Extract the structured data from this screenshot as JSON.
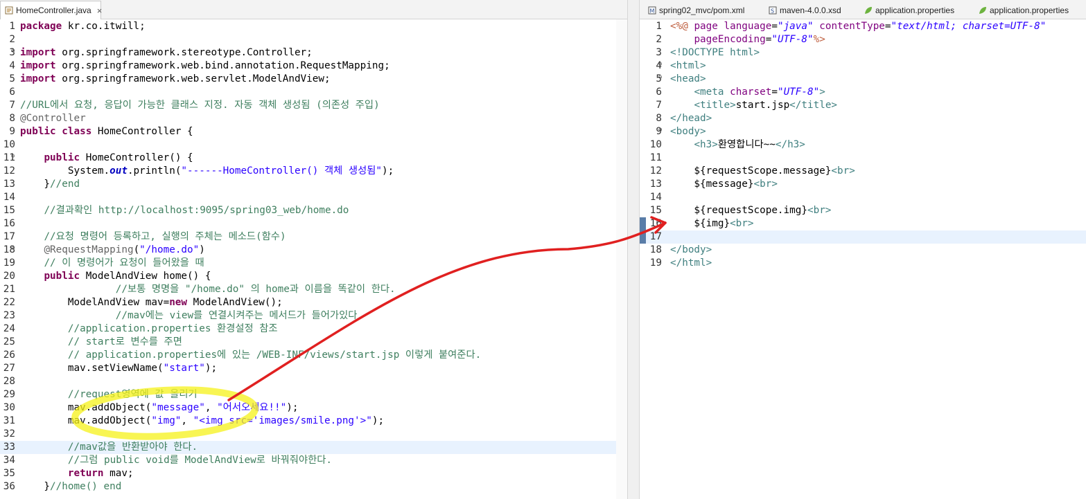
{
  "left_editor": {
    "tab": {
      "label": "HomeController.java",
      "close": "×"
    },
    "lines": [
      {
        "n": "1",
        "html": "<span class=\"kw\">package</span> kr.co.itwill;"
      },
      {
        "n": "2",
        "html": ""
      },
      {
        "n": "3",
        "fold": true,
        "html": "<span class=\"kw\">import</span> org.springframework.stereotype.Controller;"
      },
      {
        "n": "4",
        "html": "<span class=\"kw\">import</span> org.springframework.web.bind.annotation.RequestMapping;"
      },
      {
        "n": "5",
        "html": "<span class=\"kw\">import</span> org.springframework.web.servlet.ModelAndView;"
      },
      {
        "n": "6",
        "html": ""
      },
      {
        "n": "7",
        "html": "<span class=\"cm\">//URL에서 요청, 응답이 가능한 클래스 지정. 자동 객체 생성됨 (의존성 주입)</span>"
      },
      {
        "n": "8",
        "html": "<span class=\"an\">@Controller</span>"
      },
      {
        "n": "9",
        "html": "<span class=\"kw\">public</span> <span class=\"kw\">class</span> HomeController {"
      },
      {
        "n": "10",
        "html": ""
      },
      {
        "n": "11",
        "fold": true,
        "html": "    <span class=\"kw\">public</span> HomeController() {"
      },
      {
        "n": "12",
        "html": "        System.<span class=\"fld\">out</span>.println(<span class=\"st\">\"------HomeController() 객체 생성됨\"</span>);"
      },
      {
        "n": "13",
        "html": "    }<span class=\"cm\">//end</span>"
      },
      {
        "n": "14",
        "html": ""
      },
      {
        "n": "15",
        "html": "    <span class=\"cm\">//결과확인 http://localhost:9095/spring03_web/home.do</span>"
      },
      {
        "n": "16",
        "html": ""
      },
      {
        "n": "17",
        "html": "    <span class=\"cm\">//요청 명령어 등록하고, 실행의 주체는 메소드(함수)</span>"
      },
      {
        "n": "18",
        "fold": true,
        "html": "    <span class=\"an\">@RequestMapping</span>(<span class=\"st\">\"/home.do\"</span>)"
      },
      {
        "n": "19",
        "html": "    <span class=\"cm\">// 이 명령어가 요청이 들어왔을 때</span>"
      },
      {
        "n": "20",
        "html": "    <span class=\"kw\">public</span> ModelAndView home() {"
      },
      {
        "n": "21",
        "html": "                <span class=\"cm\">//보통 명명을 \"/home.do\" 의 home과 이름을 똑같이 한다.</span>"
      },
      {
        "n": "22",
        "html": "        ModelAndView mav=<span class=\"kw\">new</span> ModelAndView();"
      },
      {
        "n": "23",
        "html": "                <span class=\"cm\">//mav에는 view를 연결시켜주는 메서드가 들어가있다.</span>"
      },
      {
        "n": "24",
        "html": "        <span class=\"cm\">//application.properties 환경설정 참조</span>"
      },
      {
        "n": "25",
        "html": "        <span class=\"cm\">// start로 변수를 주면</span>"
      },
      {
        "n": "26",
        "html": "        <span class=\"cm\">// application.properties에 있는 /WEB-INF/views/start.jsp 이렇게 붙여준다.</span>"
      },
      {
        "n": "27",
        "html": "        mav.setViewName(<span class=\"st\">\"start\"</span>);"
      },
      {
        "n": "28",
        "html": ""
      },
      {
        "n": "29",
        "html": "        <span class=\"cm\">//request영역에 값 올리기</span>"
      },
      {
        "n": "30",
        "html": "        mav.addObject(<span class=\"st\">\"message\"</span>, <span class=\"st\">\"어서오세요!!\"</span>);"
      },
      {
        "n": "31",
        "html": "        mav.addObject(<span class=\"st\">\"img\"</span>, <span class=\"st\">\"&lt;img src='images/smile.png'&gt;\"</span>);"
      },
      {
        "n": "32",
        "html": ""
      },
      {
        "n": "33",
        "hl": true,
        "html": "        <span class=\"cm\">//mav값을 반환받아야 한다.</span>"
      },
      {
        "n": "34",
        "html": "        <span class=\"cm\">//그럼 public void를 ModelAndView로 바꿔줘야한다.</span>"
      },
      {
        "n": "35",
        "html": "        <span class=\"kw\">return</span> mav;"
      },
      {
        "n": "36",
        "html": "    }<span class=\"cm\">//home() end</span>"
      }
    ]
  },
  "right_editor": {
    "tabs": [
      {
        "label": "spring02_mvc/pom.xml",
        "icon": "maven-icon"
      },
      {
        "label": "maven-4.0.0.xsd",
        "icon": "xsd-icon"
      },
      {
        "label": "application.properties",
        "icon": "spring-leaf-icon"
      },
      {
        "label": "application.properties",
        "icon": "spring-leaf-icon"
      }
    ],
    "lines": [
      {
        "n": "1",
        "html": "<span class=\"jsp\">&lt;%@</span> <span class=\"at\">page</span> <span class=\"at\">language</span>=<span class=\"av\">\"java\"</span> <span class=\"at\">contentType</span>=<span class=\"av\">\"text/html; charset=UTF-8\"</span>"
      },
      {
        "n": "2",
        "html": "    <span class=\"at\">pageEncoding</span>=<span class=\"av\">\"UTF-8\"</span><span class=\"jsp\">%&gt;</span>"
      },
      {
        "n": "3",
        "html": "<span class=\"tg\">&lt;!DOCTYPE html&gt;</span>"
      },
      {
        "n": "4",
        "fold": true,
        "html": "<span class=\"tg\">&lt;html&gt;</span>"
      },
      {
        "n": "5",
        "fold": true,
        "html": "<span class=\"tg\">&lt;head&gt;</span>"
      },
      {
        "n": "6",
        "html": "    <span class=\"tg\">&lt;meta</span> <span class=\"at\">charset</span>=<span class=\"av\">\"UTF-8\"</span><span class=\"tg\">&gt;</span>"
      },
      {
        "n": "7",
        "html": "    <span class=\"tg\">&lt;title&gt;</span>start.jsp<span class=\"tg\">&lt;/title&gt;</span>"
      },
      {
        "n": "8",
        "html": "<span class=\"tg\">&lt;/head&gt;</span>"
      },
      {
        "n": "9",
        "fold": true,
        "html": "<span class=\"tg\">&lt;body&gt;</span>"
      },
      {
        "n": "10",
        "html": "    <span class=\"tg\">&lt;h3&gt;</span>환영합니다~~<span class=\"tg\">&lt;/h3&gt;</span>"
      },
      {
        "n": "11",
        "html": ""
      },
      {
        "n": "12",
        "html": "    ${requestScope.message}<span class=\"tg\">&lt;br&gt;</span>"
      },
      {
        "n": "13",
        "html": "    ${message}<span class=\"tg\">&lt;br&gt;</span>"
      },
      {
        "n": "14",
        "html": ""
      },
      {
        "n": "15",
        "html": "    ${requestScope.img}<span class=\"tg\">&lt;br&gt;</span>"
      },
      {
        "n": "16",
        "marker": true,
        "html": "    ${img}<span class=\"tg\">&lt;br&gt;</span>"
      },
      {
        "n": "17",
        "hl": true,
        "marker": true,
        "html": ""
      },
      {
        "n": "18",
        "html": "<span class=\"tg\">&lt;/body&gt;</span>"
      },
      {
        "n": "19",
        "html": "<span class=\"tg\">&lt;/html&gt;</span>"
      }
    ]
  },
  "annotation": {
    "arrow_color": "#e02020",
    "highlight_color": "#f5f21a"
  }
}
